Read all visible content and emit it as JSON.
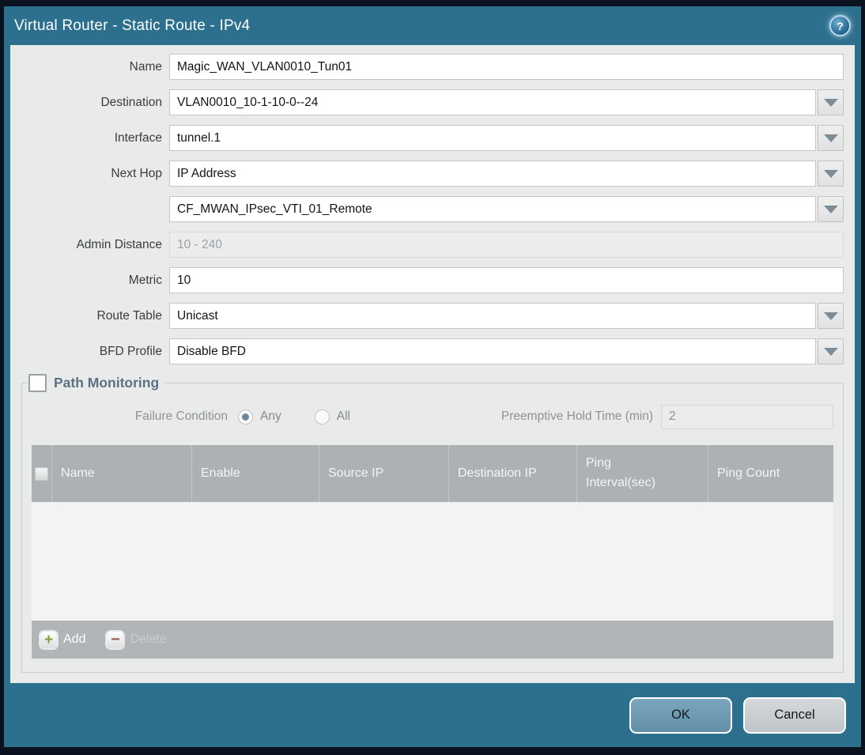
{
  "title_bar": {
    "title": "Virtual Router - Static Route - IPv4",
    "help_glyph": "?"
  },
  "form": {
    "name": {
      "label": "Name",
      "value": "Magic_WAN_VLAN0010_Tun01"
    },
    "destination": {
      "label": "Destination",
      "value": "VLAN0010_10-1-10-0--24"
    },
    "interface": {
      "label": "Interface",
      "value": "tunnel.1"
    },
    "next_hop": {
      "label": "Next Hop",
      "type_value": "IP Address",
      "address_value": "CF_MWAN_IPsec_VTI_01_Remote"
    },
    "admin_distance": {
      "label": "Admin Distance",
      "placeholder": "10 - 240",
      "value": ""
    },
    "metric": {
      "label": "Metric",
      "value": "10"
    },
    "route_table": {
      "label": "Route Table",
      "value": "Unicast"
    },
    "bfd_profile": {
      "label": "BFD Profile",
      "value": "Disable BFD"
    }
  },
  "path_monitoring": {
    "legend": "Path Monitoring",
    "checkbox_checked": false,
    "failure_condition_label": "Failure Condition",
    "radio_any_label": "Any",
    "radio_all_label": "All",
    "radio_selected": "Any",
    "preemptive_label": "Preemptive Hold Time (min)",
    "preemptive_value": "2",
    "table": {
      "columns": [
        "Name",
        "Enable",
        "Source IP",
        "Destination IP",
        "Ping Interval(sec)",
        "Ping Count"
      ],
      "rows": []
    },
    "toolbar": {
      "add_label": "Add",
      "add_glyph": "+",
      "delete_label": "Delete",
      "delete_glyph": "−"
    }
  },
  "footer": {
    "ok_label": "OK",
    "cancel_label": "Cancel"
  },
  "colors": {
    "frame_teal": "#2d708e",
    "outer_border": "#0a111f",
    "panel_gray": "#e9eaea",
    "table_header_gray": "#acb1b4",
    "add_icon_green": "#7fa33a",
    "delete_icon_red": "#9d5b52",
    "ok_button_blue": "#6e9cb4",
    "cancel_button_gray": "#cacfd3"
  }
}
